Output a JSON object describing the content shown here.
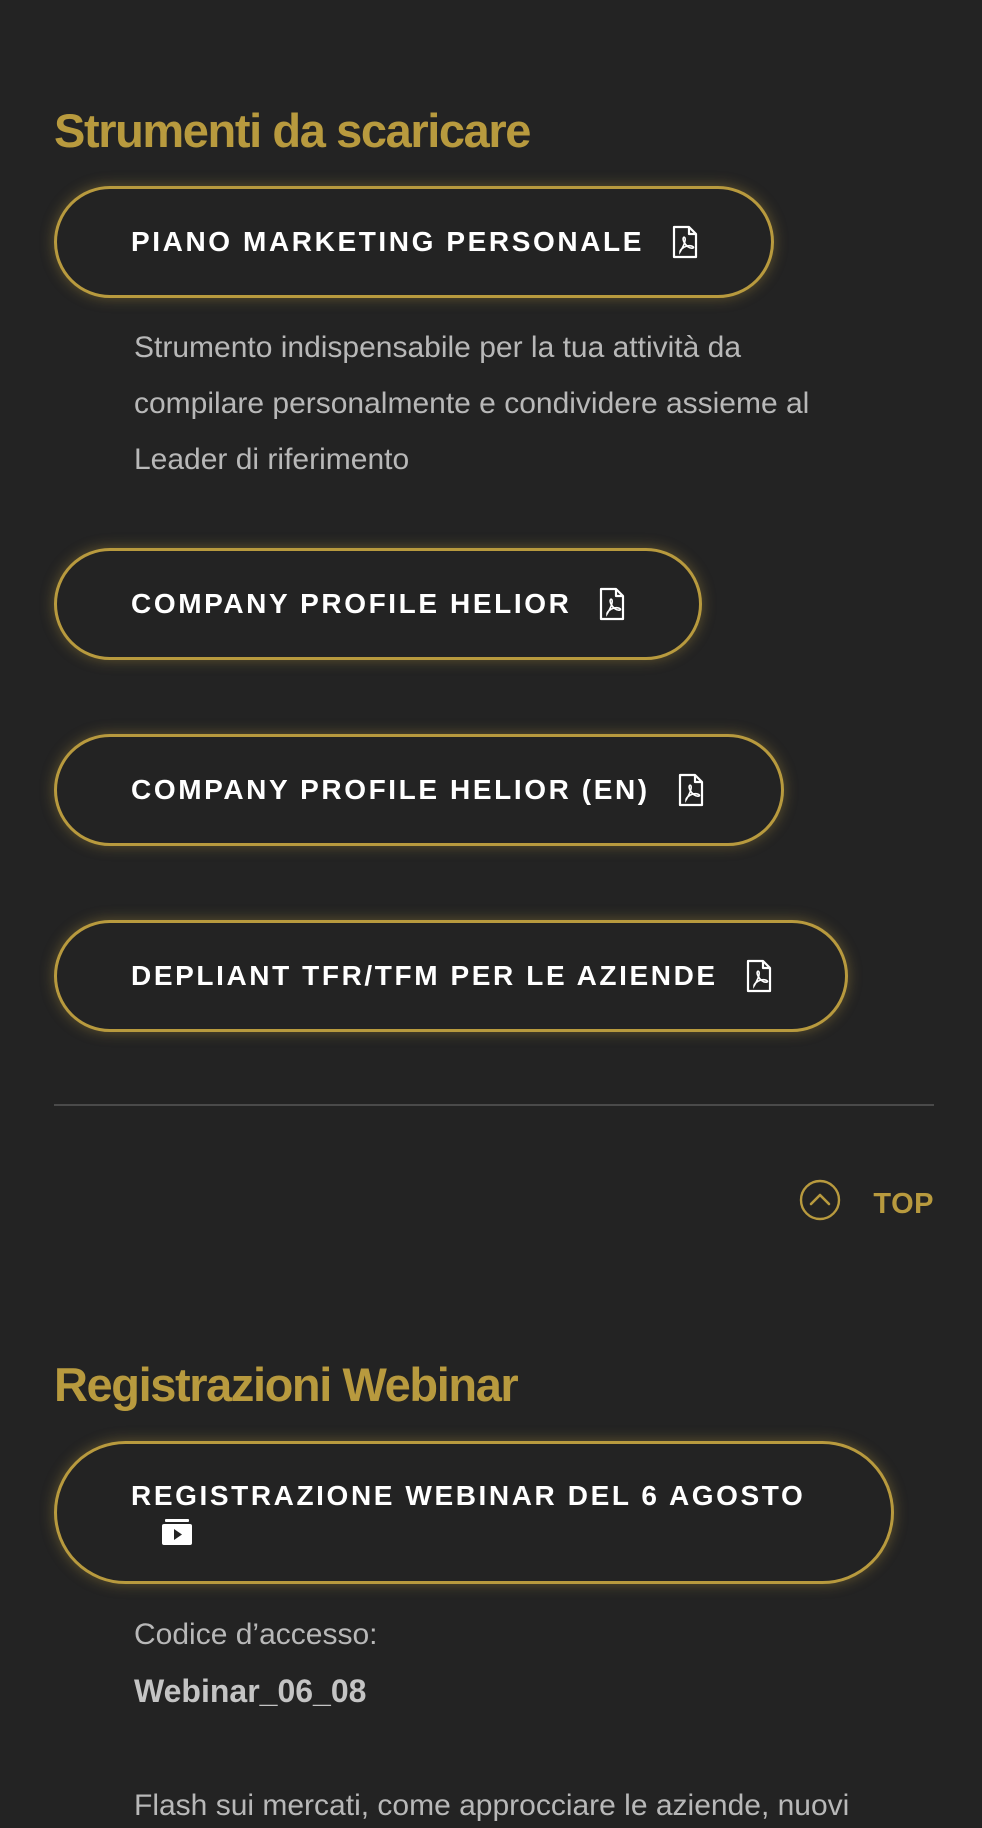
{
  "downloads": {
    "title": "Strumenti da scaricare",
    "items": [
      {
        "label": "PIANO MARKETING PERSONALE",
        "icon": "pdf-icon"
      },
      {
        "label": "COMPANY PROFILE HELIOR",
        "icon": "pdf-icon"
      },
      {
        "label": "COMPANY PROFILE HELIOR (EN)",
        "icon": "pdf-icon"
      },
      {
        "label": "DEPLIANT TFR/TFM PER LE AZIENDE",
        "icon": "pdf-icon"
      }
    ],
    "description_lines": [
      "Strumento indispensabile per la tua attività da",
      "compilare personalmente e condividere assieme al",
      "Leader di riferimento"
    ]
  },
  "top_link": {
    "label": "TOP",
    "icon": "chevron-up-circle-icon"
  },
  "webinar": {
    "title": "Registrazioni Webinar",
    "button_label": "REGISTRAZIONE WEBINAR DEL 6 AGOSTO",
    "button_icon": "video-icon",
    "access_code_label": "Codice d’accesso:",
    "access_code_value": "Webinar_06_08",
    "teaser": "Flash sui mercati, come approcciare le aziende, nuovi"
  },
  "colors": {
    "background": "#232323",
    "accent": "#b89a3e",
    "text": "#ffffff",
    "muted_text": "#b8b8b8",
    "divider": "#4a4a4a"
  }
}
